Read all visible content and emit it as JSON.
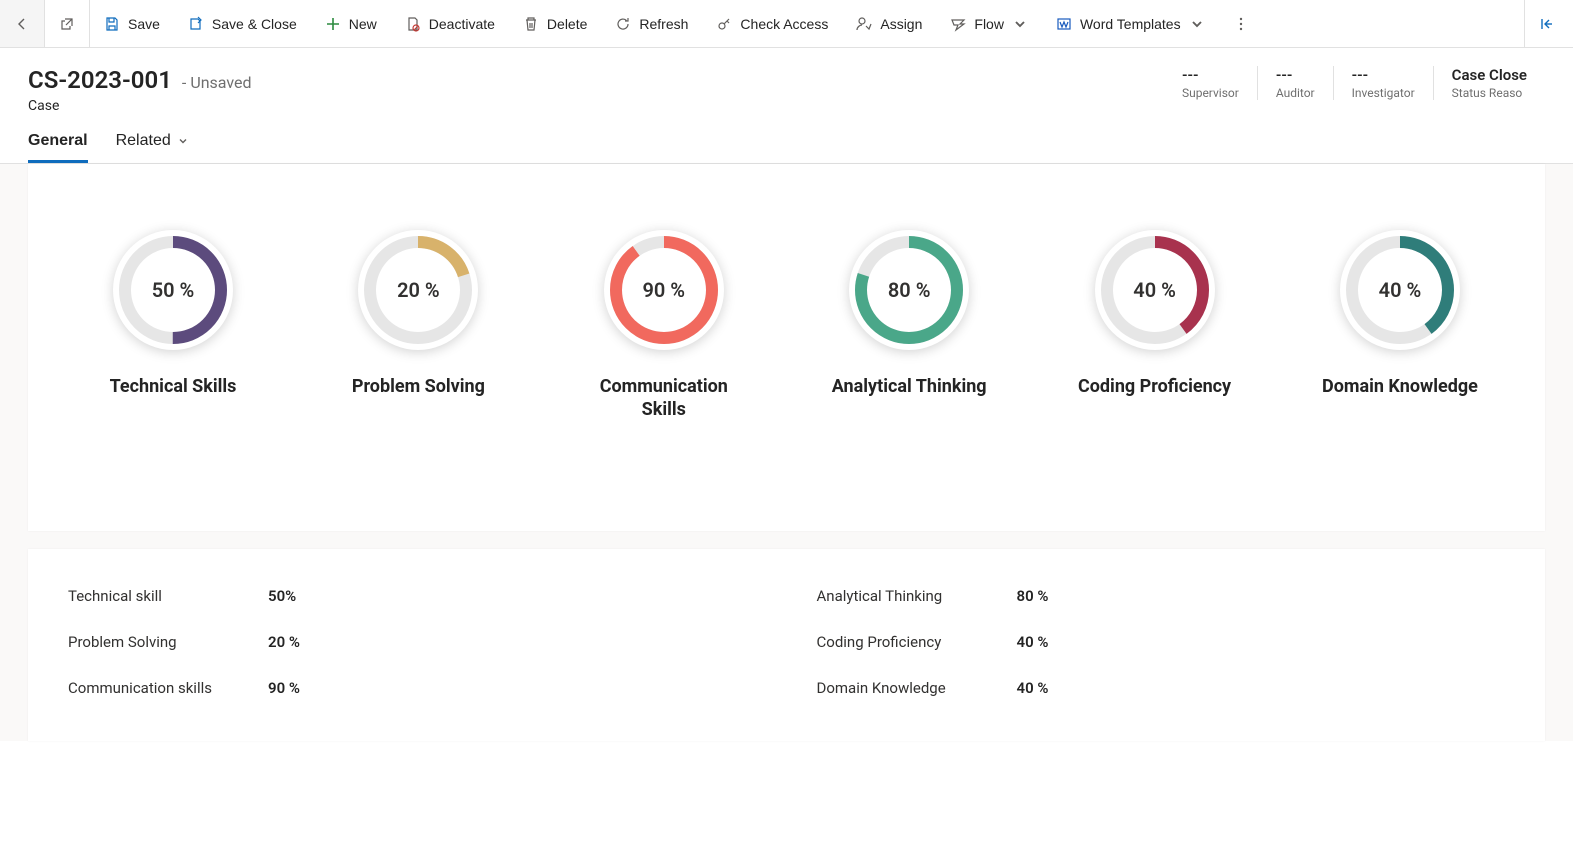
{
  "commands": {
    "save": "Save",
    "save_close": "Save & Close",
    "new": "New",
    "deactivate": "Deactivate",
    "delete": "Delete",
    "refresh": "Refresh",
    "check_access": "Check Access",
    "assign": "Assign",
    "flow": "Flow",
    "word_templates": "Word Templates"
  },
  "record": {
    "title": "CS-2023-001",
    "suffix": "- Unsaved",
    "entity": "Case"
  },
  "header_fields": [
    {
      "value": "---",
      "label": "Supervisor"
    },
    {
      "value": "---",
      "label": "Auditor"
    },
    {
      "value": "---",
      "label": "Investigator"
    },
    {
      "value": "Case Close",
      "label": "Status Reaso"
    }
  ],
  "tabs": {
    "general": "General",
    "related": "Related"
  },
  "chart_data": {
    "type": "pie",
    "gauges": [
      {
        "label": "Technical Skills",
        "value": 50,
        "display": "50 %",
        "color": "#5c4b7d"
      },
      {
        "label": "Problem Solving",
        "value": 20,
        "display": "20 %",
        "color": "#d8b26b"
      },
      {
        "label": "Communication Skills",
        "value": 90,
        "display": "90 %",
        "color": "#f1695e"
      },
      {
        "label": "Analytical Thinking",
        "value": 80,
        "display": "80 %",
        "color": "#4aa789"
      },
      {
        "label": "Coding Proficiency",
        "value": 40,
        "display": "40 %",
        "color": "#a8324e"
      },
      {
        "label": "Domain Knowledge",
        "value": 40,
        "display": "40 %",
        "color": "#2f7d7a"
      }
    ]
  },
  "details": {
    "left": [
      {
        "label": "Technical skill",
        "value": "50%"
      },
      {
        "label": "Problem Solving",
        "value": "20 %"
      },
      {
        "label": "Communication skills",
        "value": "90 %"
      }
    ],
    "right": [
      {
        "label": "Analytical Thinking",
        "value": "80 %"
      },
      {
        "label": "Coding Proficiency",
        "value": "40 %"
      },
      {
        "label": "Domain Knowledge",
        "value": "40 %"
      }
    ]
  }
}
